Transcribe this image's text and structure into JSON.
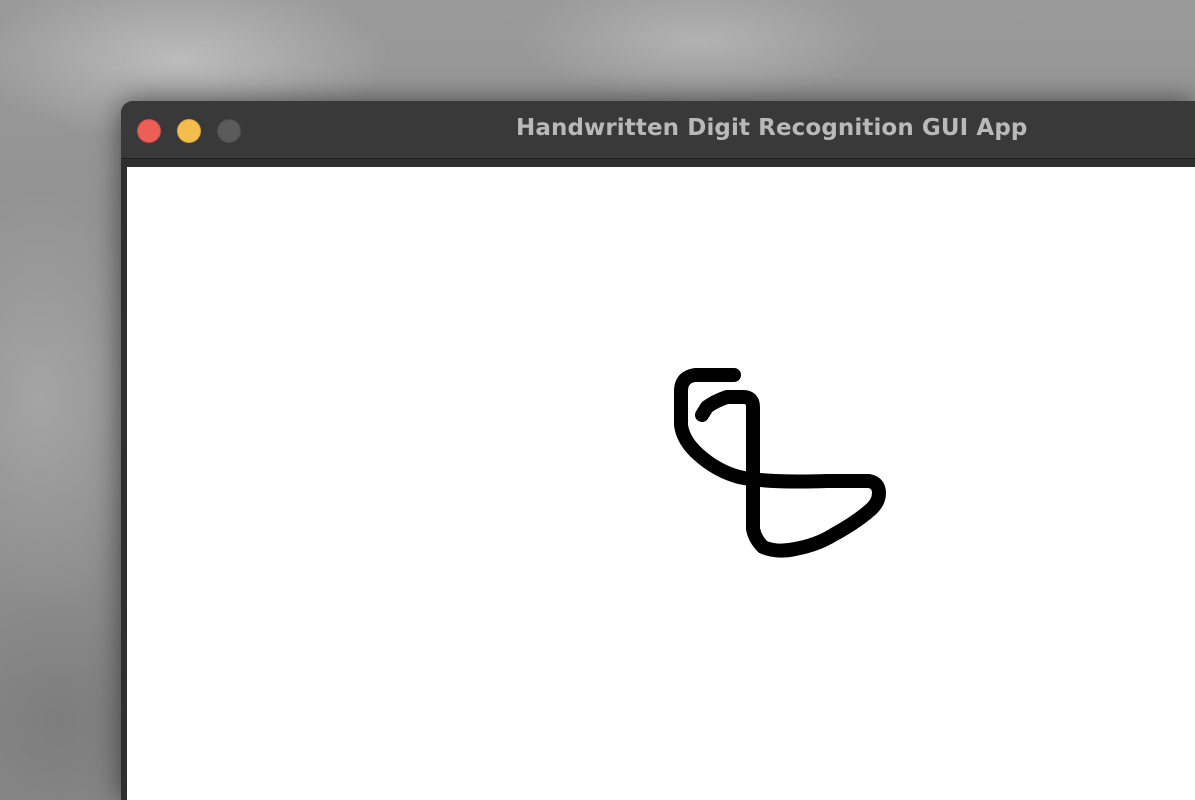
{
  "window": {
    "title": "Handwritten Digit Recognition GUI App"
  },
  "traffic_lights": {
    "close_color": "#ec5f57",
    "minimize_color": "#f4be4f",
    "zoom_color": "#5b5b5b"
  },
  "canvas": {
    "background": "#ffffff",
    "stroke_color": "#000000",
    "content": "hand-drawn digit stroke"
  }
}
